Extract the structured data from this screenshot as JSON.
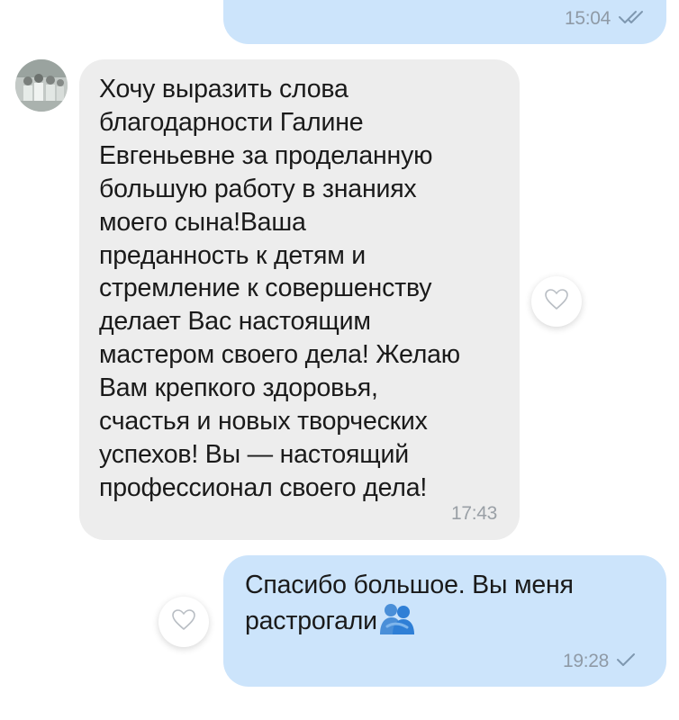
{
  "messages": {
    "top_outgoing": {
      "time": "15:04",
      "status_icon": "double-check-icon"
    },
    "incoming": {
      "lines": [
        "Хочу выразить слова",
        "благодарности Галине",
        "Евгеньевне за проделанную",
        "большую работу в знаниях",
        "моего сына!Ваша",
        "преданность к детям и",
        "стремление к совершенству",
        "делает Вас настоящим",
        "мастером своего дела! Желаю",
        "Вам крепкого здоровья,",
        "счастья и новых творческих",
        "успехов! Вы — настоящий",
        "профессионал своего дела!"
      ],
      "time": "17:43"
    },
    "bottom_outgoing": {
      "line1": "Спасибо большое. Вы меня",
      "line2": "растрогали",
      "emoji_icon": "people-hugging-icon",
      "time": "19:28",
      "status_icon": "single-check-icon"
    }
  },
  "colors": {
    "outgoing_bubble": "#cce4fb",
    "incoming_bubble": "#ededed",
    "timestamp": "#8f9aa6",
    "check": "#7f98b0",
    "emoji": "#2f7fd6"
  }
}
